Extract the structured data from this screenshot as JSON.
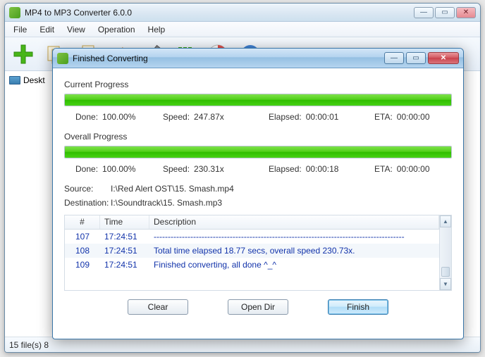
{
  "main": {
    "title": "MP4 to MP3 Converter 6.0.0",
    "menu": {
      "file": "File",
      "edit": "Edit",
      "view": "View",
      "operation": "Operation",
      "help": "Help"
    },
    "left": {
      "desktop": "Deskt"
    },
    "status": "15 file(s)    8"
  },
  "dialog": {
    "title": "Finished Converting",
    "current": {
      "label": "Current Progress",
      "done_lbl": "Done:",
      "done_val": "100.00%",
      "speed_lbl": "Speed:",
      "speed_val": "247.87x",
      "elapsed_lbl": "Elapsed:",
      "elapsed_val": "00:00:01",
      "eta_lbl": "ETA:",
      "eta_val": "00:00:00"
    },
    "overall": {
      "label": "Overall Progress",
      "done_lbl": "Done:",
      "done_val": "100.00%",
      "speed_lbl": "Speed:",
      "speed_val": "230.31x",
      "elapsed_lbl": "Elapsed:",
      "elapsed_val": "00:00:18",
      "eta_lbl": "ETA:",
      "eta_val": "00:00:00"
    },
    "source_lbl": "Source:",
    "source_val": "I:\\Red Alert OST\\15. Smash.mp4",
    "dest_lbl": "Destination:",
    "dest_val": "I:\\Soundtrack\\15. Smash.mp3",
    "log": {
      "header": {
        "num": "#",
        "time": "Time",
        "desc": "Description"
      },
      "rows": [
        {
          "num": "107",
          "time": "17:24:51",
          "desc": "-----------------------------------------------------------------------------------------"
        },
        {
          "num": "108",
          "time": "17:24:51",
          "desc": "Total time elapsed 18.77 secs, overall speed 230.73x."
        },
        {
          "num": "109",
          "time": "17:24:51",
          "desc": "Finished converting, all done ^_^"
        }
      ]
    },
    "buttons": {
      "clear": "Clear",
      "open_dir": "Open Dir",
      "finish": "Finish"
    }
  }
}
